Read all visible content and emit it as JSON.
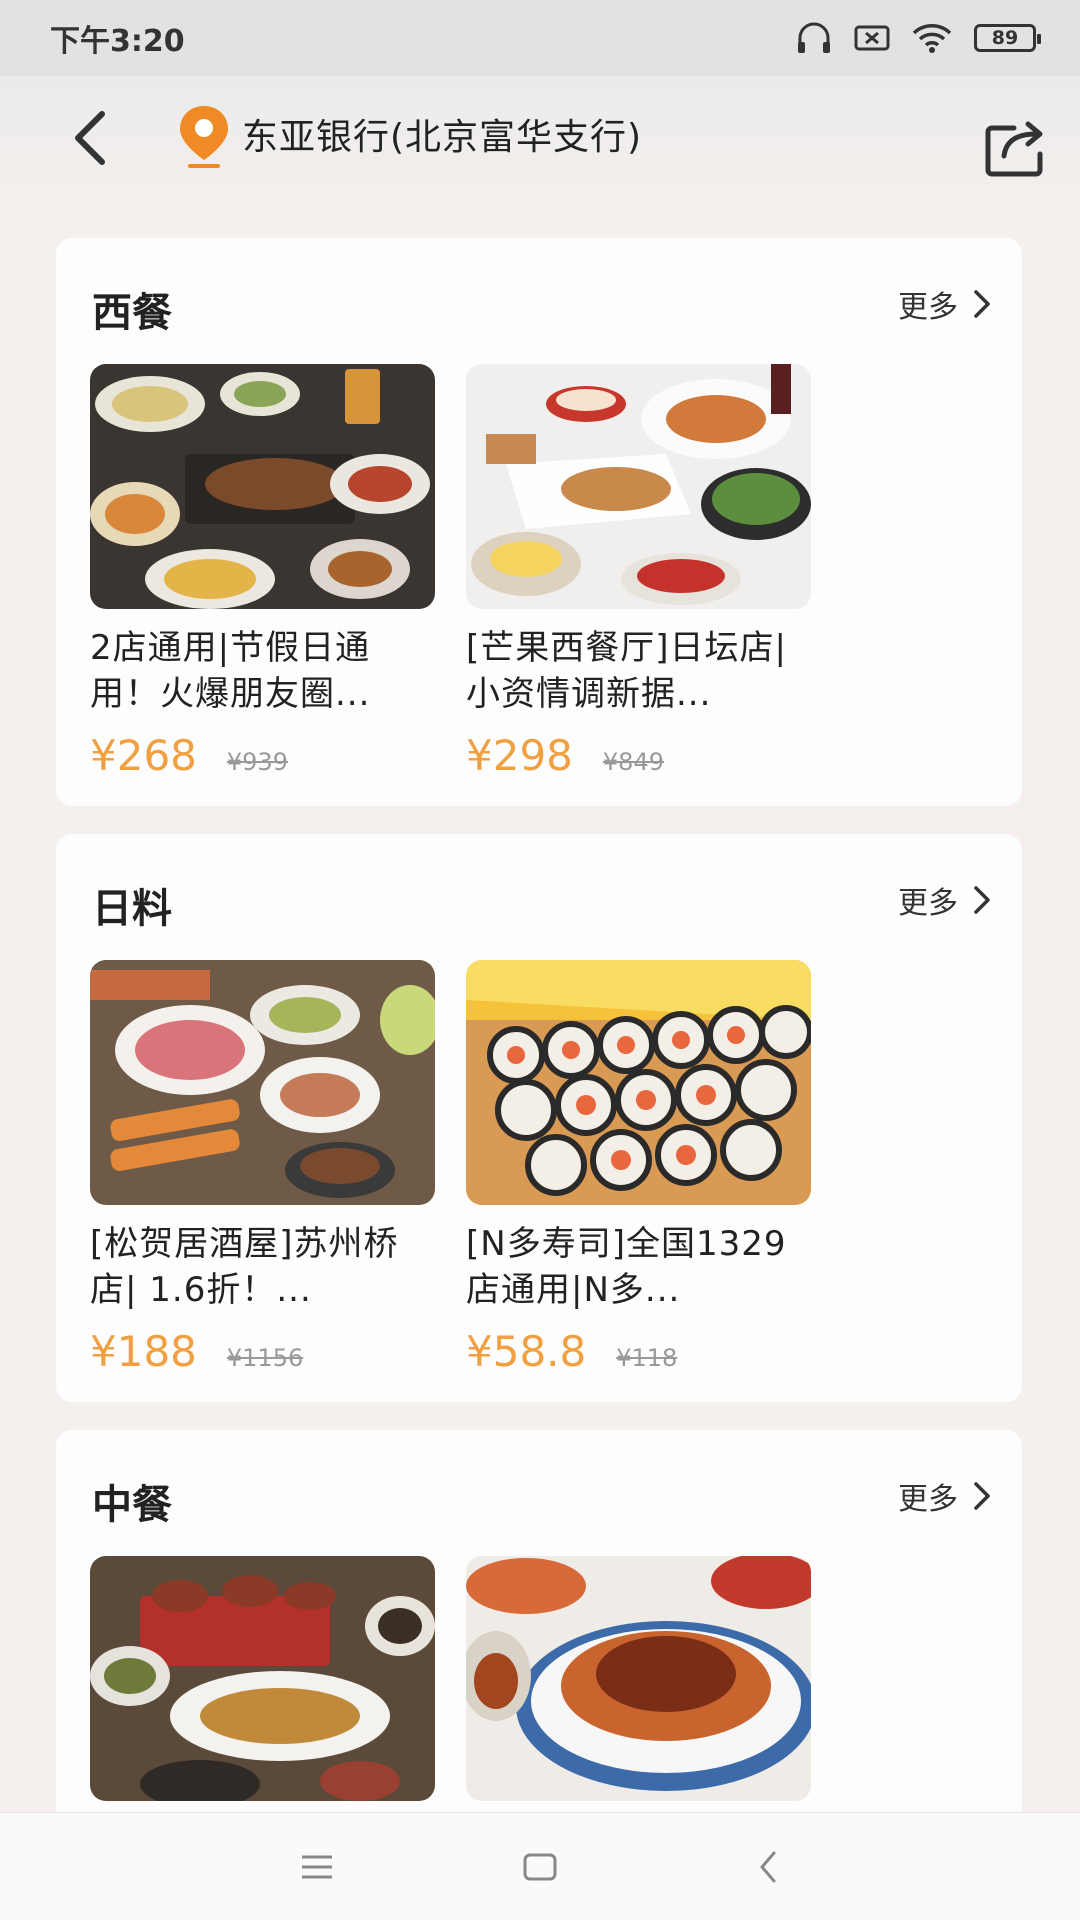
{
  "status_bar": {
    "time": "下午3:20",
    "battery": "89",
    "icons": [
      "headset-icon",
      "sim-none-icon",
      "wifi-icon",
      "battery-icon"
    ]
  },
  "header": {
    "title": "东亚银行(北京富华支行)",
    "icons": [
      "back-icon",
      "location-pin-icon",
      "share-icon"
    ]
  },
  "colors": {
    "accent": "#f0a040",
    "background": "#f5f0ee",
    "pin": "#f08a24"
  },
  "sections": [
    {
      "title": "西餐",
      "more_label": "更多",
      "items": [
        {
          "title": "2店通用|节假日通用！火爆朋友圈...",
          "price": "¥268",
          "original_price": "¥939"
        },
        {
          "title": "[芒果西餐厅]日坛店|小资情调新据...",
          "price": "¥298",
          "original_price": "¥849"
        }
      ]
    },
    {
      "title": "日料",
      "more_label": "更多",
      "items": [
        {
          "title": "[松贺居酒屋]苏州桥店| 1.6折！...",
          "price": "¥188",
          "original_price": "¥1156"
        },
        {
          "title": "[N多寿司]全国1329店通用|N多...",
          "price": "¥58.8",
          "original_price": "¥118"
        }
      ]
    },
    {
      "title": "中餐",
      "more_label": "更多",
      "items": [
        {
          "title": "",
          "price": "",
          "original_price": ""
        },
        {
          "title": "",
          "price": "",
          "original_price": ""
        }
      ]
    }
  ],
  "system_nav": {
    "icons": [
      "menu-icon",
      "home-icon",
      "back-nav-icon"
    ]
  }
}
